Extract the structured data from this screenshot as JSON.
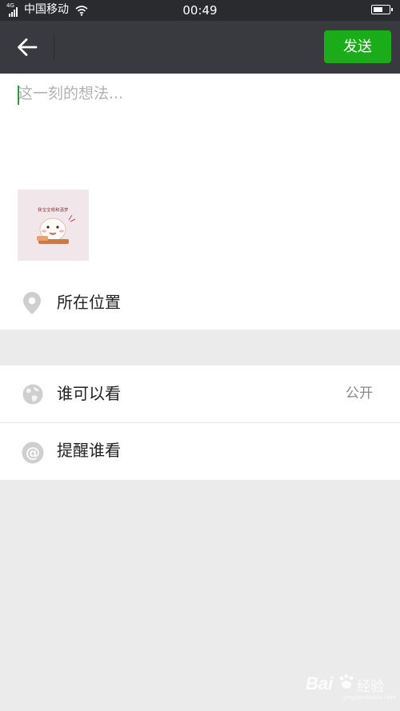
{
  "status_bar": {
    "signal_label": "4G",
    "carrier": "中国移动",
    "time": "00:49"
  },
  "nav": {
    "send_label": "发送"
  },
  "compose": {
    "placeholder": "这一刻的想法...",
    "value": "",
    "photo_caption": "我宝宝帽和酒梦"
  },
  "rows": {
    "location_label": "所在位置",
    "visibility_label": "谁可以看",
    "visibility_value": "公开",
    "remind_label": "提醒谁看"
  },
  "watermark": {
    "brand": "Bai",
    "brand_suffix": "经验",
    "url": "jingyan.baidu.com"
  },
  "colors": {
    "send_button": "#1aad19",
    "navbar": "#393a3f",
    "statusbar": "#2a2b2f",
    "background": "#ebebeb"
  },
  "icons": {
    "back": "arrow-left-icon",
    "location": "location-pin-icon",
    "visibility": "globe-icon",
    "remind": "at-sign-icon"
  }
}
